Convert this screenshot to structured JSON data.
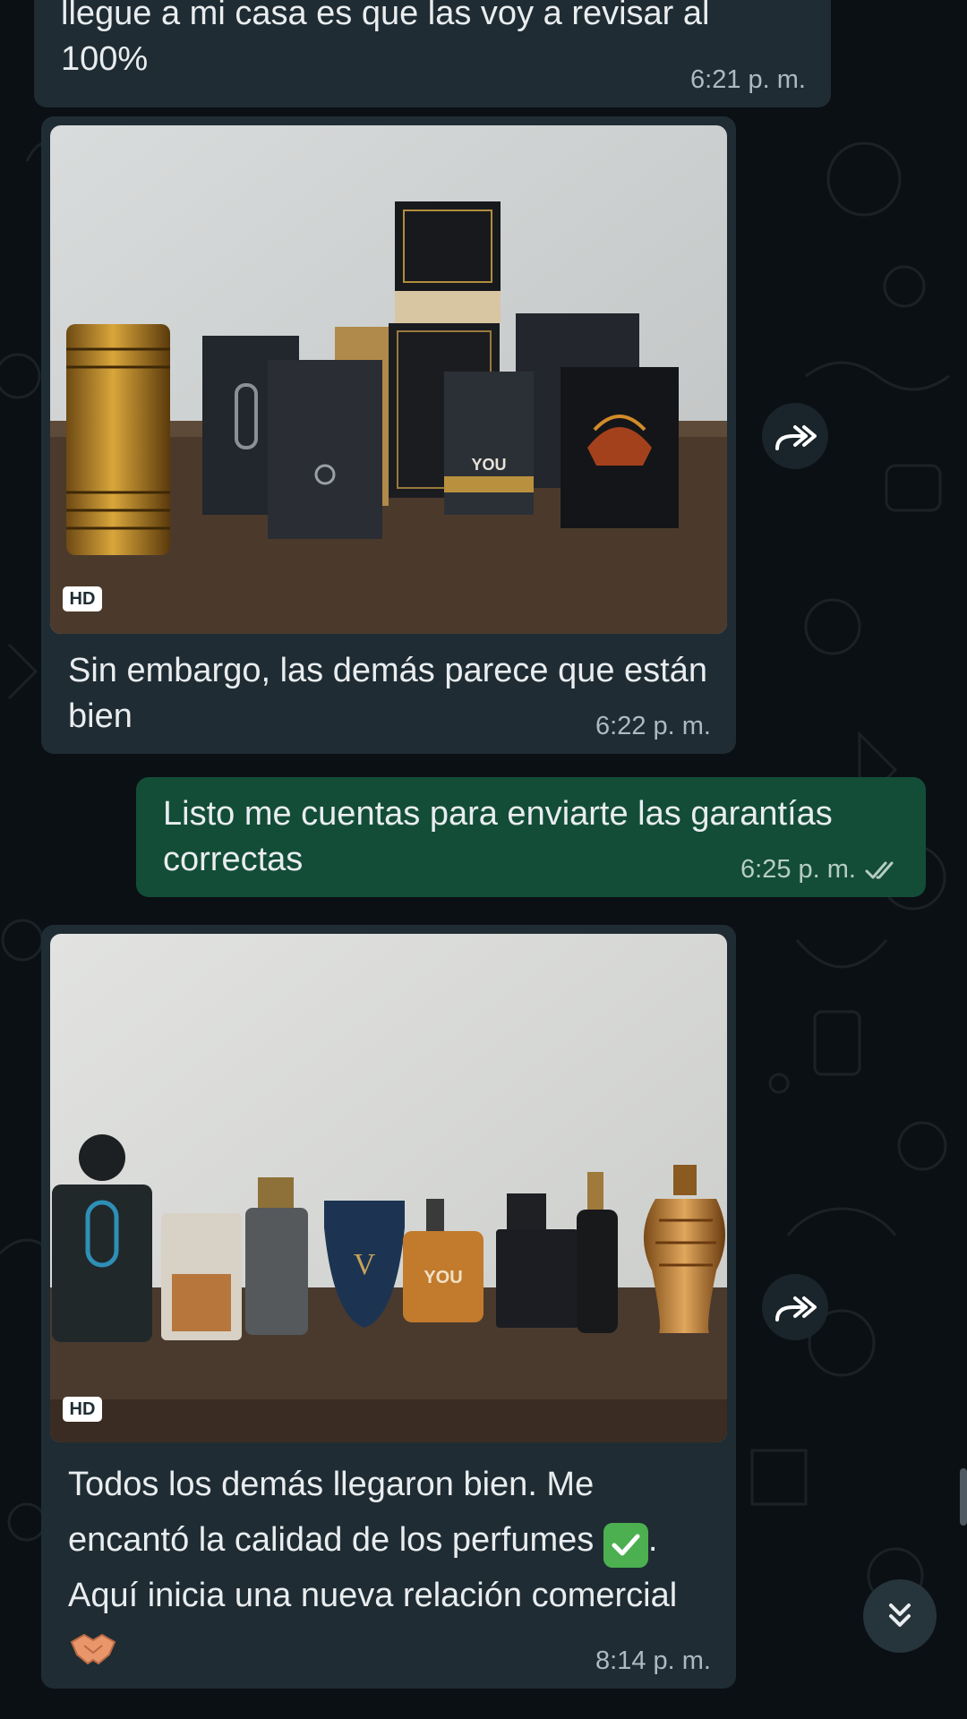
{
  "messages": [
    {
      "id": "m1",
      "direction": "incoming",
      "text_line1": "llegue a mi casa es que las voy a revisar al",
      "text_line2": "100%",
      "time": "6:21 p. m."
    },
    {
      "id": "m2",
      "direction": "incoming",
      "has_photo": true,
      "photo_badge": "HD",
      "photo_visible_text": [
        "YOU"
      ],
      "caption": "Sin embargo, las demás parece que están bien",
      "time": "6:22 p. m."
    },
    {
      "id": "m3",
      "direction": "outgoing",
      "text": "Listo me cuentas para enviarte las garantías correctas",
      "time": "6:25 p. m.",
      "status": "read"
    },
    {
      "id": "m4",
      "direction": "incoming",
      "has_photo": true,
      "photo_badge": "HD",
      "photo_visible_text": [
        "YOU",
        "V"
      ],
      "caption_part1": "Todos los demás llegaron bien. Me encantó la calidad de los perfumes",
      "caption_part2": ". Aquí inicia una nueva relación comercial",
      "time": "8:14 p. m."
    }
  ],
  "icons": {
    "forward": "forward-arrow-icon",
    "scroll_down": "double-chevron-down-icon",
    "read_receipt": "double-check-icon",
    "check_emoji": "check-mark-button-emoji",
    "handshake_emoji": "handshake-emoji"
  },
  "colors": {
    "background": "#0b1014",
    "incoming_bubble": "#1f2c33",
    "outgoing_bubble": "#134d37",
    "timestamp": "#aebac1",
    "read_check": "#aebac1"
  }
}
